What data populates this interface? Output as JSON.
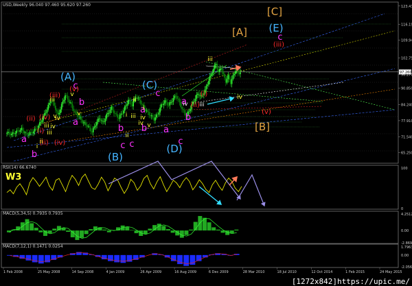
{
  "colors": {
    "bg": "#000000",
    "frame": "#7a7a7a",
    "grid": "#3a3a3a",
    "candle_up": "#33ff33",
    "candle_down": "#0a8a0a",
    "rsi": "#e6e600",
    "macd_hist": "#22aa22",
    "macd_line": "#33ff33",
    "macd2_hist": "#1b2bff",
    "macd2_line": "#dd2222",
    "axis_text": "#d0d0d0",
    "wave_blue": "#45b4ff",
    "wave_orange": "#e3a443",
    "wave_magenta": "#ff33ff",
    "wave_red": "#ff2a2a",
    "wave_yellow": "#ffff33",
    "wave_white": "#ffffff",
    "arrow_purple": "#9b8fe8",
    "arrow_cyan": "#33ddff",
    "arrow_salmon": "#ff7a5a"
  },
  "header": {
    "main": "USD,Weekly 96.040 97.460 95.620 97.260",
    "rsi": "RSI(14) 66.6740",
    "macd1": "MACD(5,34,5) 0.7935 0.7935",
    "macd2": "MACD(7,12,1) 0.1471 0.0254"
  },
  "credit": "[1272x842]https://upic.me/",
  "study_label": "W3",
  "chart_data": [
    {
      "type": "candlestick",
      "name": "main",
      "ylim": [
        61,
        125
      ],
      "y_ticks": [
        {
          "v": 123.43,
          "t": "123.430"
        },
        {
          "v": 116.19,
          "t": "116.190"
        },
        {
          "v": 109.94,
          "t": "109.940"
        },
        {
          "v": 102.75,
          "t": "102.750"
        },
        {
          "v": 96.27,
          "t": "96.270"
        },
        {
          "v": 90.85,
          "t": "90.850"
        },
        {
          "v": 84.24,
          "t": "84.240"
        },
        {
          "v": 77.91,
          "t": "77.910"
        },
        {
          "v": 71.54,
          "t": "71.540"
        },
        {
          "v": 65.25,
          "t": "65.250"
        }
      ],
      "price_marker": {
        "v": 97.26,
        "t": "97.260"
      },
      "x_ticks": [
        "1 Feb 2008",
        "25 May 2008",
        "14 Sep 2008",
        "4 Jan 2009",
        "26 Apr 2009",
        "16 Aug 2009",
        "6 Dec 2009",
        "28 Mar 2010",
        "18 Jul 2010",
        "12 Oct 2014",
        "1 Feb 2015",
        "24 May 2015"
      ],
      "price_path": [
        [
          0,
          73.0
        ],
        [
          4,
          72.5
        ],
        [
          8,
          73.5
        ],
        [
          12,
          74.5
        ],
        [
          16,
          72.5
        ],
        [
          20,
          73.0
        ],
        [
          25,
          75.0
        ],
        [
          29,
          78.5
        ],
        [
          33,
          82.5
        ],
        [
          36,
          86.0
        ],
        [
          39,
          84.0
        ],
        [
          42,
          80.0
        ],
        [
          45,
          84.0
        ],
        [
          48,
          88.0
        ],
        [
          52,
          85.0
        ],
        [
          56,
          81.0
        ],
        [
          60,
          79.0
        ],
        [
          63,
          77.0
        ],
        [
          66,
          76.0
        ],
        [
          70,
          73.5
        ],
        [
          73,
          76.5
        ],
        [
          76,
          79.0
        ],
        [
          79,
          77.0
        ],
        [
          82,
          80.0
        ],
        [
          86,
          83.0
        ],
        [
          89,
          80.5
        ],
        [
          92,
          79.0
        ],
        [
          96,
          82.0
        ],
        [
          100,
          86.0
        ],
        [
          103,
          84.0
        ],
        [
          106,
          87.5
        ],
        [
          109,
          86.0
        ],
        [
          112,
          83.5
        ],
        [
          115,
          81.5
        ],
        [
          118,
          80.0
        ],
        [
          121,
          78.5
        ],
        [
          124,
          80.5
        ],
        [
          127,
          84.0
        ],
        [
          130,
          85.5
        ],
        [
          133,
          84.0
        ],
        [
          136,
          86.0
        ],
        [
          139,
          88.0
        ],
        [
          142,
          85.0
        ],
        [
          145,
          81.5
        ],
        [
          148,
          80.0
        ],
        [
          151,
          83.0
        ],
        [
          154,
          86.0
        ],
        [
          157,
          88.5
        ],
        [
          160,
          87.5
        ],
        [
          163,
          90.0
        ],
        [
          166,
          94.0
        ],
        [
          169,
          97.5
        ],
        [
          172,
          100.5
        ],
        [
          174,
          97.0
        ],
        [
          176,
          99.0
        ],
        [
          178,
          96.0
        ],
        [
          180,
          93.5
        ],
        [
          182,
          95.5
        ],
        [
          184,
          93.0
        ],
        [
          186,
          95.5
        ],
        [
          188,
          98.0
        ],
        [
          190,
          96.5
        ],
        [
          192,
          97.26
        ]
      ],
      "n_bars": 193
    },
    {
      "type": "line",
      "name": "RSI(14)",
      "ylim": [
        0,
        100
      ],
      "y_ticks": [
        {
          "v": 100,
          "t": "100"
        },
        {
          "v": 0,
          "t": "0"
        }
      ],
      "values": [
        38,
        44,
        35,
        50,
        58,
        47,
        33,
        60,
        72,
        63,
        52,
        62,
        73,
        53,
        43,
        66,
        70,
        55,
        40,
        61,
        77,
        68,
        54,
        72,
        80,
        64,
        49,
        45,
        57,
        73,
        62,
        42,
        56,
        71,
        66,
        50,
        36,
        48,
        68,
        60,
        43,
        53,
        70,
        77,
        58,
        46,
        62,
        74,
        56,
        40,
        52,
        66,
        60,
        49,
        63,
        72,
        63,
        44,
        54,
        67,
        58,
        45,
        38,
        56,
        66,
        53,
        43,
        60,
        71,
        63,
        48,
        40,
        52
      ]
    },
    {
      "type": "bar+line",
      "name": "MACD(5,34,5)",
      "y_ticks": [
        {
          "v": 4.2512,
          "t": "4.2512"
        },
        {
          "v": 0,
          "t": "0.00"
        },
        {
          "v": -2.8699,
          "t": "-2.8699"
        }
      ],
      "values": [
        -0.4,
        0.2,
        0.9,
        1.8,
        2.5,
        1.6,
        0.6,
        -0.4,
        -1.2,
        -0.6,
        0.4,
        1.0,
        0.6,
        -0.3,
        -1.5,
        -2.1,
        -1.6,
        -0.8,
        0.3,
        0.9,
        0.7,
        0.2,
        -0.4,
        0.1,
        0.7,
        1.1,
        0.8,
        0.1,
        -0.6,
        -1.2,
        -0.8,
        0.4,
        1.2,
        1.5,
        1.0,
        0.3,
        -0.5,
        -1.1,
        -1.6,
        -1.0,
        0.2,
        1.9,
        3.2,
        2.8,
        1.8,
        0.7,
        0.2,
        -0.5,
        -1.0,
        -0.6,
        0.2
      ]
    },
    {
      "type": "bar+line",
      "name": "MACD(7,12,1)",
      "y_ticks": [
        {
          "v": 1.7963,
          "t": "1.7963"
        },
        {
          "v": 0,
          "t": "0.00"
        },
        {
          "v": -2.0567,
          "t": "-2.0567"
        }
      ],
      "values": [
        -0.1,
        -0.3,
        -0.6,
        -0.9,
        -1.2,
        -1.4,
        -1.2,
        -0.8,
        -0.4,
        0.0,
        0.3,
        0.5,
        0.4,
        0.1,
        -0.3,
        -0.7,
        -1.0,
        -1.2,
        -1.3,
        -1.1,
        -0.8,
        -0.4,
        0.0,
        0.3,
        0.1,
        -0.4,
        -1.0,
        -1.5,
        -1.8,
        -1.6,
        -1.0,
        -0.4,
        0.1,
        0.3,
        0.2,
        -0.1,
        0.2
      ]
    }
  ],
  "wave_labels": [
    {
      "t": "(A)",
      "c": "wave_blue",
      "s": 15
    },
    {
      "t": "(C)",
      "c": "wave_blue",
      "s": 15
    },
    {
      "t": "(E)",
      "c": "wave_blue",
      "s": 15
    },
    {
      "t": "(B)",
      "c": "wave_blue",
      "s": 15
    },
    {
      "t": "(D)",
      "c": "wave_blue",
      "s": 15
    },
    {
      "t": "[C]",
      "c": "wave_orange",
      "s": 15
    },
    {
      "t": "[A]",
      "c": "wave_orange",
      "s": 15
    },
    {
      "t": "[B]",
      "c": "wave_orange",
      "s": 15
    },
    {
      "t": "c",
      "c": "wave_magenta",
      "s": 13
    },
    {
      "t": "c",
      "c": "wave_magenta",
      "s": 13
    },
    {
      "t": "c",
      "c": "wave_magenta",
      "s": 13
    },
    {
      "t": "c",
      "c": "wave_magenta",
      "s": 13
    },
    {
      "t": "a",
      "c": "wave_magenta",
      "s": 13
    },
    {
      "t": "a",
      "c": "wave_magenta",
      "s": 13
    },
    {
      "t": "a",
      "c": "wave_magenta",
      "s": 13
    },
    {
      "t": "a",
      "c": "wave_magenta",
      "s": 13
    },
    {
      "t": "a",
      "c": "wave_magenta",
      "s": 13
    },
    {
      "t": "b",
      "c": "wave_magenta",
      "s": 13
    },
    {
      "t": "b",
      "c": "wave_magenta",
      "s": 13
    },
    {
      "t": "b",
      "c": "wave_magenta",
      "s": 13
    },
    {
      "t": "b",
      "c": "wave_magenta",
      "s": 13
    },
    {
      "t": "b",
      "c": "wave_magenta",
      "s": 13
    },
    {
      "t": "c",
      "c": "wave_magenta",
      "s": 13
    },
    {
      "t": "c",
      "c": "wave_magenta",
      "s": 13
    },
    {
      "t": "(v)",
      "c": "wave_red",
      "s": 10
    },
    {
      "t": "(iii)",
      "c": "wave_red",
      "s": 10
    },
    {
      "t": "(iv)",
      "c": "wave_red",
      "s": 10
    },
    {
      "t": "(ii)",
      "c": "wave_red",
      "s": 10
    },
    {
      "t": "(iv)",
      "c": "wave_red",
      "s": 10
    },
    {
      "t": "(ii)",
      "c": "wave_red",
      "s": 10
    },
    {
      "t": "(i)",
      "c": "wave_red",
      "s": 10
    },
    {
      "t": "(iii)",
      "c": "wave_red",
      "s": 10
    },
    {
      "t": "(ii)",
      "c": "wave_red",
      "s": 10
    },
    {
      "t": "(v)",
      "c": "wave_red",
      "s": 10
    },
    {
      "t": "(i)",
      "c": "wave_red",
      "s": 10
    },
    {
      "t": "iii",
      "c": "wave_yellow",
      "s": 9
    },
    {
      "t": "v",
      "c": "wave_yellow",
      "s": 9
    },
    {
      "t": "iv",
      "c": "wave_yellow",
      "s": 9
    },
    {
      "t": "iv",
      "c": "wave_yellow",
      "s": 9
    },
    {
      "t": "v",
      "c": "wave_yellow",
      "s": 9
    },
    {
      "t": "ii",
      "c": "wave_yellow",
      "s": 9
    },
    {
      "t": "i",
      "c": "wave_yellow",
      "s": 9
    },
    {
      "t": "iii",
      "c": "wave_yellow",
      "s": 9
    },
    {
      "t": "v",
      "c": "wave_yellow",
      "s": 9
    },
    {
      "t": "iv",
      "c": "wave_yellow",
      "s": 9
    },
    {
      "t": "i",
      "c": "wave_yellow",
      "s": 9
    },
    {
      "t": "ii",
      "c": "wave_yellow",
      "s": 9
    },
    {
      "t": "iii",
      "c": "wave_yellow",
      "s": 9
    },
    {
      "t": "iv",
      "c": "wave_yellow",
      "s": 9
    },
    {
      "t": "iii",
      "c": "wave_yellow",
      "s": 9
    },
    {
      "t": "iv",
      "c": "wave_yellow",
      "s": 9
    },
    {
      "t": "i",
      "c": "wave_yellow",
      "s": 9
    },
    {
      "t": "ii",
      "c": "wave_yellow",
      "s": 9
    },
    {
      "t": "iii",
      "c": "wave_yellow",
      "s": 9
    },
    {
      "t": "v",
      "c": "wave_yellow",
      "s": 9
    },
    {
      "t": "iv",
      "c": "wave_white",
      "s": 8
    },
    {
      "t": "iii",
      "c": "wave_white",
      "s": 8
    }
  ]
}
